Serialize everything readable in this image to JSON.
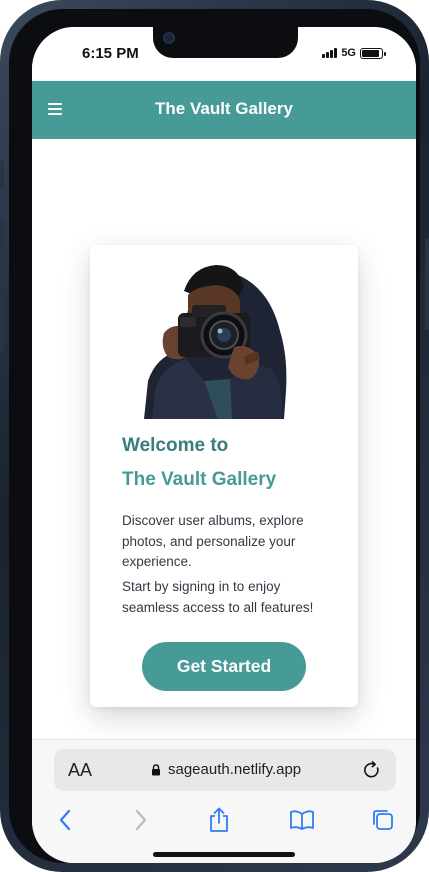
{
  "status_bar": {
    "time": "6:15 PM",
    "network": "5G",
    "battery_level": 0.9
  },
  "app": {
    "title": "The Vault Gallery",
    "menu_icon": "hamburger-menu-icon",
    "accent_color": "#469b97"
  },
  "welcome_card": {
    "heading_line1": "Welcome to",
    "heading_line2": "The Vault Gallery",
    "description": "Discover user albums, explore photos, and personalize your experience.",
    "subtext": "Start by signing in to enjoy seamless access to all features!",
    "cta_label": "Get Started"
  },
  "browser": {
    "text_size_label": "AA",
    "url": "sageauth.netlify.app",
    "icons": [
      "lock-icon",
      "reload-icon",
      "back-icon",
      "forward-icon",
      "share-icon",
      "bookmarks-icon",
      "tabs-icon"
    ]
  }
}
